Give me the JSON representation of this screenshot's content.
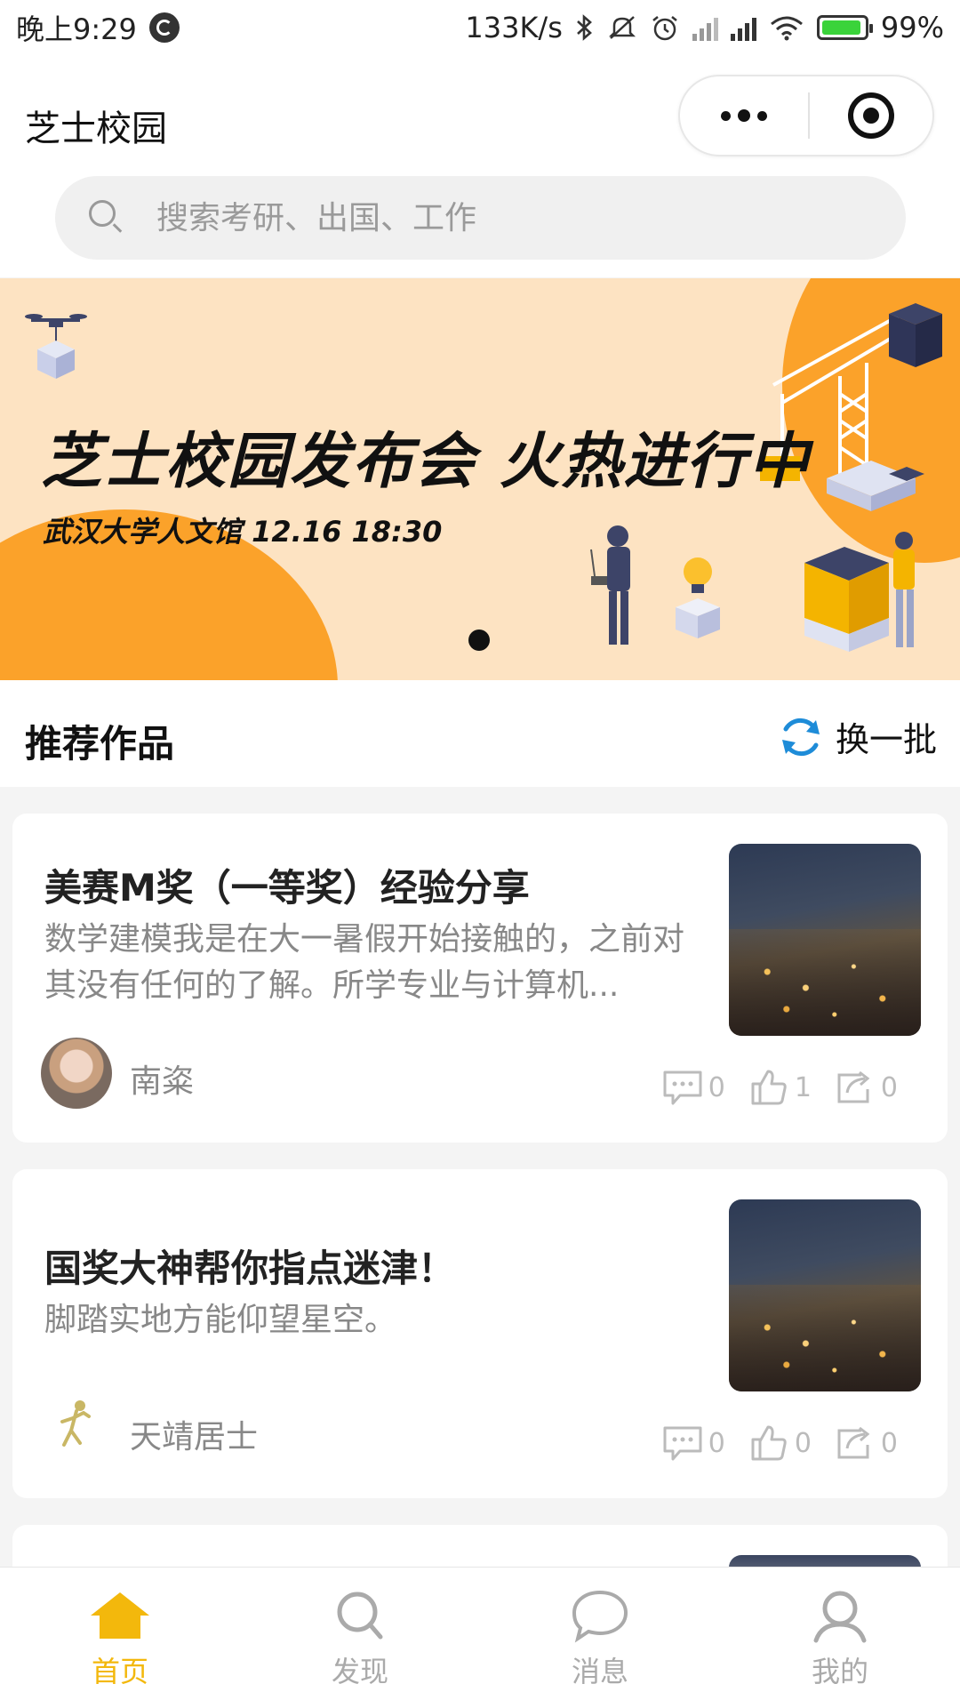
{
  "status_bar": {
    "time": "晚上9:29",
    "net_speed": "133K/s",
    "battery": "99%"
  },
  "nav": {
    "title": "芝士校园"
  },
  "search": {
    "placeholder": "搜索考研、出国、工作"
  },
  "banner": {
    "headline": "芝士校园发布会 火热进行中",
    "subline": "武汉大学人文馆  12.16  18:30",
    "slide_index": 1,
    "slide_count": 1
  },
  "section": {
    "title": "推荐作品",
    "refresh_label": "换一批"
  },
  "cards": [
    {
      "title": "美赛M奖（一等奖）经验分享",
      "desc": "数学建模我是在大一暑假开始接触的，之前对其没有任何的了解。所学专业与计算机...",
      "author": "南粢",
      "comments": "0",
      "likes": "1",
      "shares": "0"
    },
    {
      "title": "国奖大神帮你指点迷津！",
      "desc": "脚踏实地方能仰望星空。",
      "author": "天靖居士",
      "comments": "0",
      "likes": "0",
      "shares": "0"
    }
  ],
  "tabbar": {
    "items": [
      {
        "label": "首页",
        "icon": "home-icon",
        "active": true
      },
      {
        "label": "发现",
        "icon": "search-icon",
        "active": false
      },
      {
        "label": "消息",
        "icon": "chat-icon",
        "active": false
      },
      {
        "label": "我的",
        "icon": "person-icon",
        "active": false
      }
    ]
  },
  "colors": {
    "accent": "#f3b80c",
    "banner_bg": "#fde3c2",
    "banner_orange": "#fba22a"
  }
}
